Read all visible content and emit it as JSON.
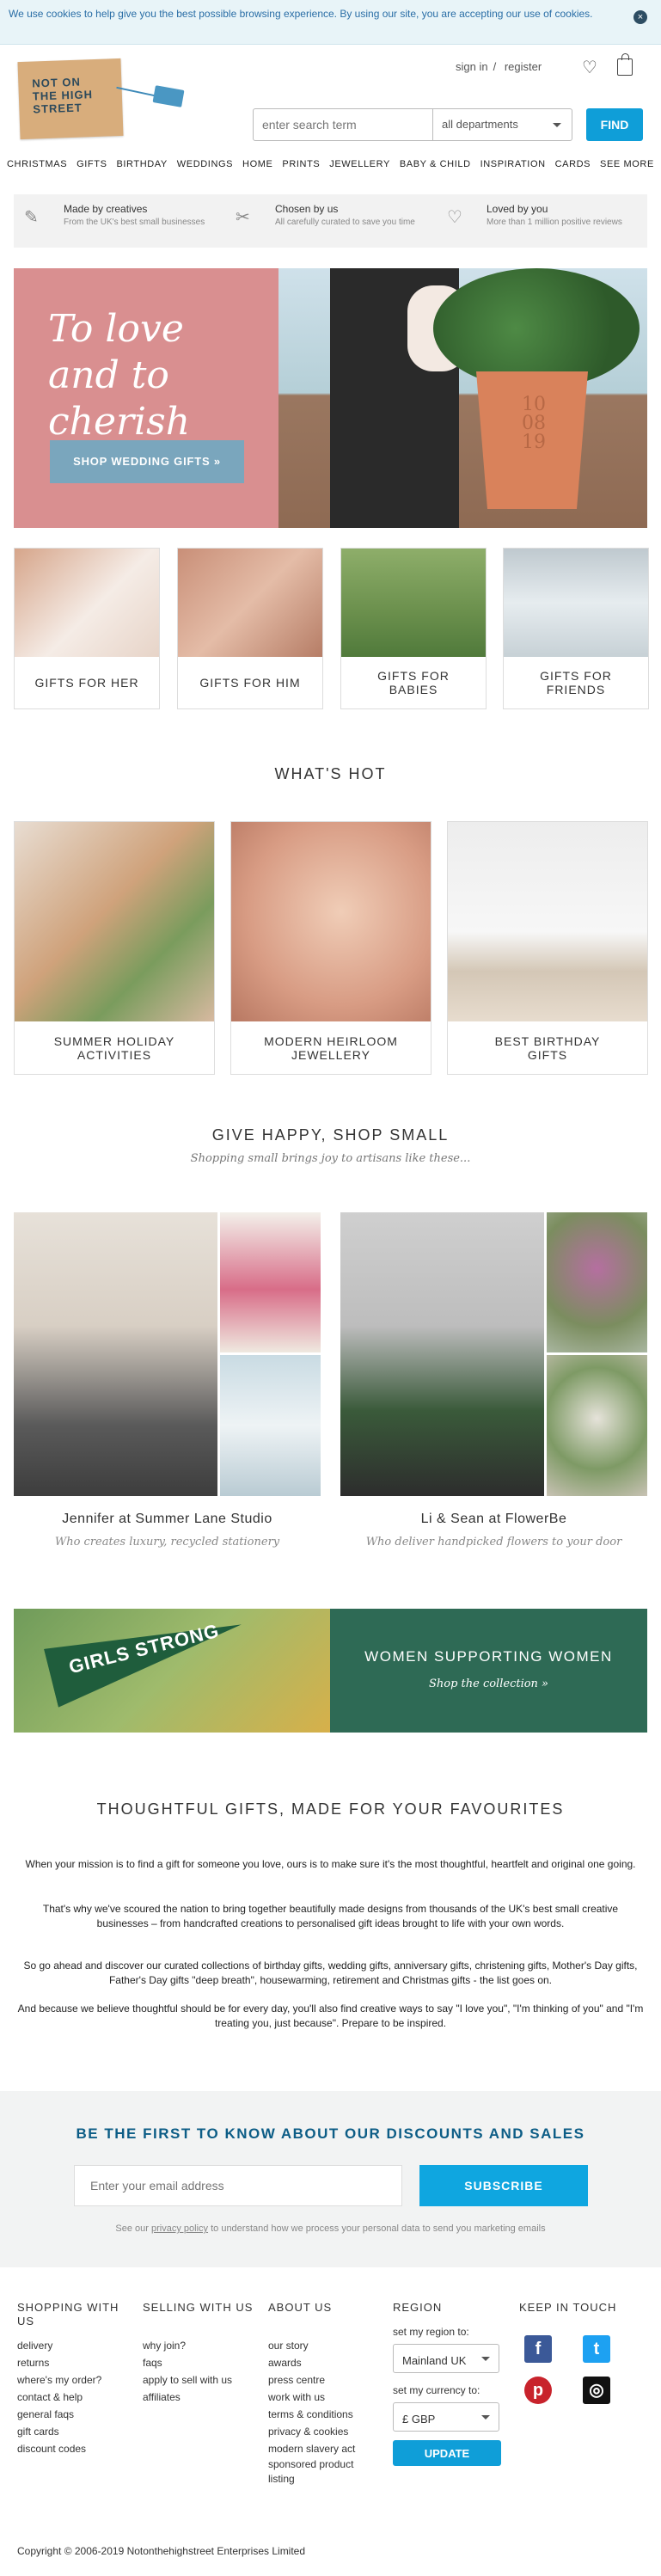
{
  "cookie": {
    "text": "We use cookies to help give you the best possible browsing experience. By using our site, you are accepting our use of cookies.",
    "close": "×"
  },
  "logo": {
    "text": "NOT ON THE HIGH STREET"
  },
  "account": {
    "sign_in": "sign in",
    "sep": "/",
    "register": "register"
  },
  "search": {
    "placeholder": "enter search term",
    "department": "all departments",
    "button": "FIND"
  },
  "nav": [
    "CHRISTMAS",
    "GIFTS",
    "BIRTHDAY",
    "WEDDINGS",
    "HOME",
    "PRINTS",
    "JEWELLERY",
    "BABY & CHILD",
    "INSPIRATION",
    "CARDS",
    "SEE MORE"
  ],
  "props": [
    {
      "title": "Made by creatives",
      "desc": "From the UK's best small businesses"
    },
    {
      "title": "Chosen by us",
      "desc": "All carefully curated to save you time"
    },
    {
      "title": "Loved by you",
      "desc": "More than 1 million positive reviews"
    }
  ],
  "hero": {
    "heading": "To love and to cherish",
    "cta": "SHOP WEDDING GIFTS »",
    "pot_date": "10 08 19"
  },
  "categories": [
    "GIFTS FOR HER",
    "GIFTS FOR HIM",
    "GIFTS FOR BABIES",
    "GIFTS FOR FRIENDS"
  ],
  "whats_hot": {
    "title": "WHAT'S HOT",
    "items": [
      "SUMMER HOLIDAY ACTIVITIES",
      "MODERN HEIRLOOM JEWELLERY",
      "BEST BIRTHDAY GIFTS"
    ]
  },
  "shop_small": {
    "title": "GIVE HAPPY, SHOP SMALL",
    "subtitle": "Shopping small brings joy to artisans like these...",
    "artisans": [
      {
        "name": "Jennifer at Summer Lane Studio",
        "desc": "Who creates luxury, recycled stationery"
      },
      {
        "name": "Li & Sean at FlowerBe",
        "desc": "Who deliver handpicked flowers to your door"
      }
    ]
  },
  "banner": {
    "title": "WOMEN SUPPORTING WOMEN",
    "link": "Shop the collection »",
    "pennant": "GIRLS STRONG"
  },
  "about": {
    "title": "THOUGHTFUL GIFTS, MADE FOR YOUR FAVOURITES",
    "p1": "When your mission is to find a gift for someone you love, ours is to make sure it's the most thoughtful, heartfelt and original one going.",
    "p2": "That's why we've scoured the nation to bring together beautifully made designs from thousands of the UK's best small creative businesses – from handcrafted creations to personalised gift ideas brought to life with your own words.",
    "p3": "So go ahead and discover our curated collections of birthday gifts, wedding gifts, anniversary gifts, christening gifts, Mother's Day gifts, Father's Day gifts \"deep breath\", housewarming, retirement and Christmas gifts - the list goes on.",
    "p4": "And because we believe thoughtful should be for every day, you'll also find creative ways to say \"I love you\", \"I'm thinking of you\" and \"I'm treating you, just because\". Prepare to be inspired."
  },
  "newsletter": {
    "title": "BE THE FIRST TO KNOW ABOUT OUR DISCOUNTS AND SALES",
    "placeholder": "Enter your email address",
    "button": "SUBSCRIBE",
    "fine_pre": "See our",
    "fine_link": "privacy policy",
    "fine_post": "to understand how we process your personal data to send you marketing emails"
  },
  "footer": {
    "shopping": {
      "title": "SHOPPING WITH US",
      "links": [
        "delivery",
        "returns",
        "where's my order?",
        "contact & help",
        "general faqs",
        "gift cards",
        "discount codes"
      ]
    },
    "selling": {
      "title": "SELLING WITH US",
      "links": [
        "why join?",
        "faqs",
        "apply to sell with us",
        "affiliates"
      ]
    },
    "about": {
      "title": "ABOUT US",
      "links": [
        "our story",
        "awards",
        "press centre",
        "work with us",
        "terms & conditions",
        "privacy & cookies",
        "modern slavery act",
        "sponsored product listing"
      ]
    },
    "region": {
      "title": "REGION",
      "region_label": "set my region to:",
      "region_value": "Mainland UK",
      "currency_label": "set my currency to:",
      "currency_value": "£ GBP",
      "button": "UPDATE"
    },
    "social": {
      "title": "KEEP IN TOUCH"
    },
    "copyright": "Copyright © 2006-2019 Notonthehighstreet Enterprises Limited"
  },
  "colors": {
    "accent": "#0f9ed8",
    "hero_pink": "#d98f90",
    "banner_green": "#2e6a55",
    "cta_blue": "#7aa6bd"
  }
}
